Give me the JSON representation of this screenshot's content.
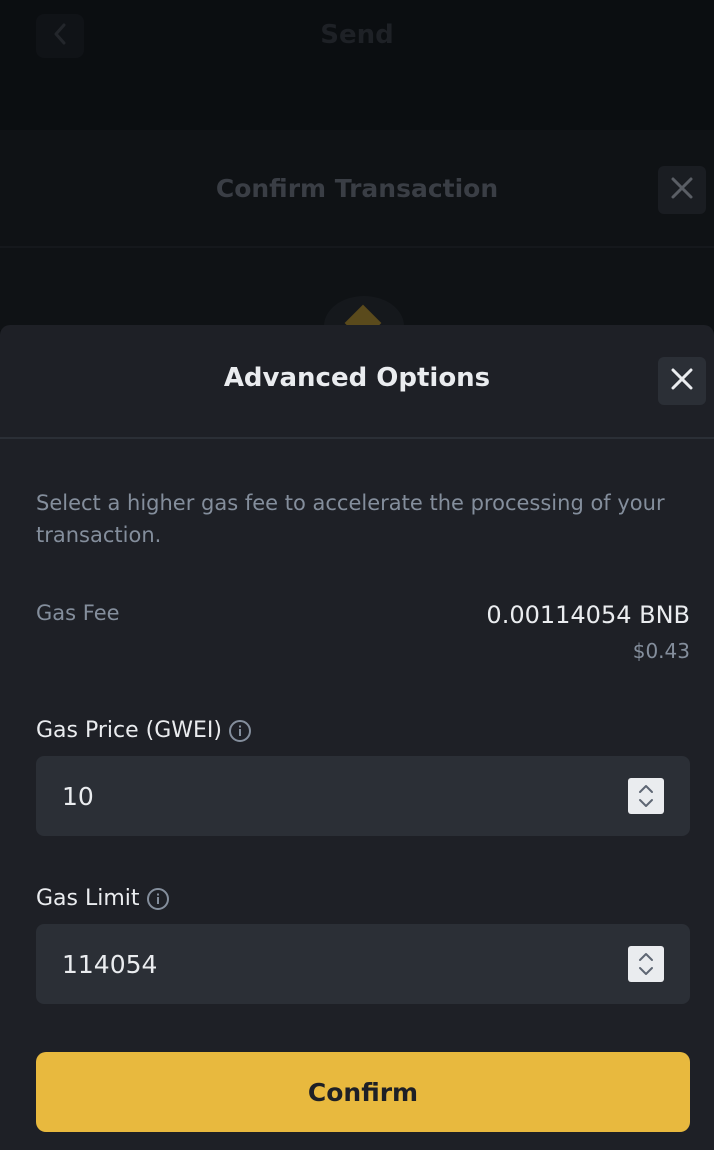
{
  "background": {
    "page_title": "Send",
    "sheet_title": "Confirm Transaction"
  },
  "modal": {
    "title": "Advanced Options",
    "description": "Select a higher gas fee to accelerate the processing of your transaction.",
    "gas_fee": {
      "label": "Gas Fee",
      "amount": "0.00114054 BNB",
      "usd": "$0.43"
    },
    "gas_price": {
      "label": "Gas Price (GWEI)",
      "value": "10"
    },
    "gas_limit": {
      "label": "Gas Limit",
      "value": "114054"
    },
    "confirm_label": "Confirm"
  },
  "colors": {
    "accent": "#e8b93e",
    "modal_bg": "#1e2026",
    "input_bg": "#2b2f36",
    "muted_text": "#848e9c"
  },
  "icons": [
    "back-arrow-icon",
    "close-icon",
    "info-icon",
    "stepper-icon",
    "bnb-logo-icon"
  ]
}
